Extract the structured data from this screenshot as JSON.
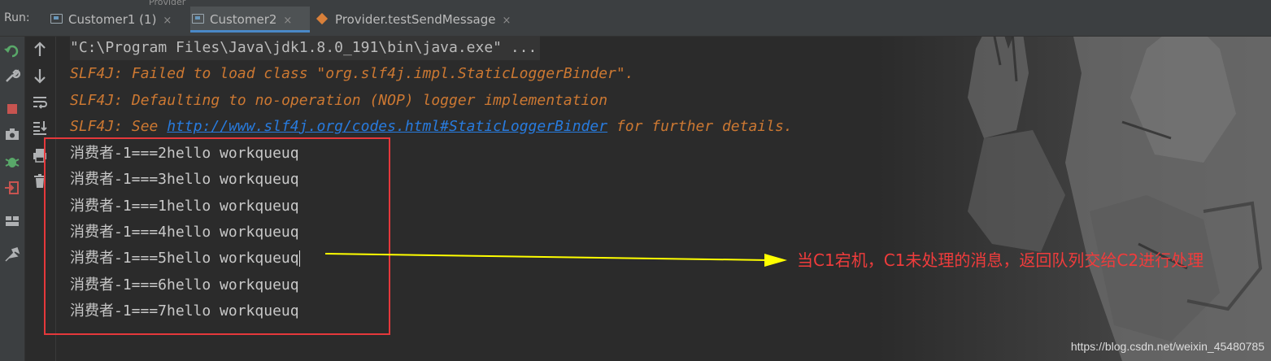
{
  "run_label": "Run:",
  "peek_tab": "Provider",
  "tabs": [
    {
      "label": "Customer1 (1)",
      "close": "×",
      "icon": "console-icon",
      "active": false
    },
    {
      "label": "Customer2",
      "close": "×",
      "icon": "console-icon",
      "active": true
    },
    {
      "label": "Provider.testSendMessage",
      "close": "×",
      "icon": "test-diamond-icon",
      "active": false
    }
  ],
  "tools_left": [
    "rerun-icon",
    "wrench-icon",
    "stop-icon",
    "camera-icon",
    "debug-icon",
    "exit-icon",
    "layout-icon",
    "pin-icon"
  ],
  "tools_right": [
    "up-arrow-icon",
    "down-arrow-icon",
    "soft-wrap-icon",
    "scroll-to-end-icon",
    "print-icon",
    "trash-icon"
  ],
  "console": {
    "command": "\"C:\\Program Files\\Java\\jdk1.8.0_191\\bin\\java.exe\" ...",
    "warn1": "SLF4J: Failed to load class \"org.slf4j.impl.StaticLoggerBinder\".",
    "warn2": "SLF4J: Defaulting to no-operation (NOP) logger implementation",
    "warn3_prefix": "SLF4J: See ",
    "warn3_link": "http://www.slf4j.org/codes.html#StaticLoggerBinder",
    "warn3_suffix": " for further details.",
    "outputs": [
      "消费者-1===2hello workqueuq",
      "消费者-1===3hello workqueuq",
      "消费者-1===1hello workqueuq",
      "消费者-1===4hello workqueuq",
      "消费者-1===5hello workqueuq",
      "消费者-1===6hello workqueuq",
      "消费者-1===7hello workqueuq"
    ]
  },
  "annotation": "当C1宕机，C1未处理的消息，返回队列交给C2进行处理",
  "watermark": "https://blog.csdn.net/weixin_45480785",
  "colors": {
    "annotation": "#f03c3c",
    "arrow": "#ffff00",
    "box": "#e5383b",
    "warning": "#cc7832",
    "link": "#287bde"
  }
}
